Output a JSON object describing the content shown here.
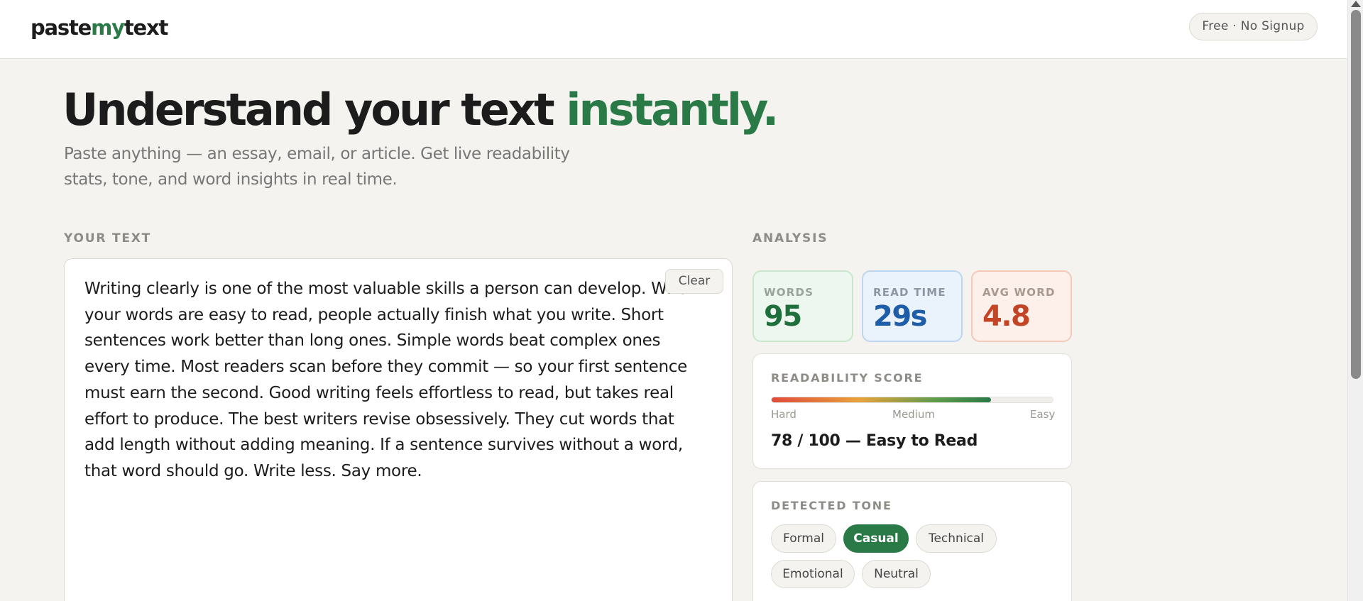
{
  "header": {
    "logo_prefix": "paste",
    "logo_accent": "my",
    "logo_suffix": "text",
    "badge": "Free · No Signup"
  },
  "hero": {
    "title_main": "Understand your text ",
    "title_accent": "instantly.",
    "subtitle": "Paste anything — an essay, email, or article. Get live readability stats, tone, and word insights in real time."
  },
  "editor": {
    "label": "YOUR TEXT",
    "clear_label": "Clear",
    "content": "Writing clearly is one of the most valuable skills a person can develop. When your words are easy to read, people actually finish what you write. Short sentences work better than long ones. Simple words beat complex ones every time. Most readers scan before they commit — so your first sentence must earn the second. Good writing feels effortless to read, but takes real effort to produce. The best writers revise obsessively. They cut words that add length without adding meaning. If a sentence survives without a word, that word should go. Write less. Say more."
  },
  "analysis": {
    "label": "ANALYSIS",
    "stats": {
      "words_label": "WORDS",
      "words_value": "95",
      "read_label": "READ TIME",
      "read_value": "29s",
      "avg_label": "AVG WORD",
      "avg_value": "4.8"
    },
    "readability": {
      "label": "READABILITY SCORE",
      "score_fraction": 0.78,
      "scale_hard": "Hard",
      "scale_medium": "Medium",
      "scale_easy": "Easy",
      "summary": "78 / 100 — Easy to Read"
    },
    "tone": {
      "label": "DETECTED TONE",
      "options": [
        "Formal",
        "Casual",
        "Technical",
        "Emotional",
        "Neutral"
      ],
      "selected": "Casual"
    }
  },
  "colors": {
    "accent": "#2a7a47",
    "words": "#1f6f3c",
    "read_time": "#1e5ea8",
    "avg_word": "#c44426",
    "background": "#f4f3f0"
  }
}
